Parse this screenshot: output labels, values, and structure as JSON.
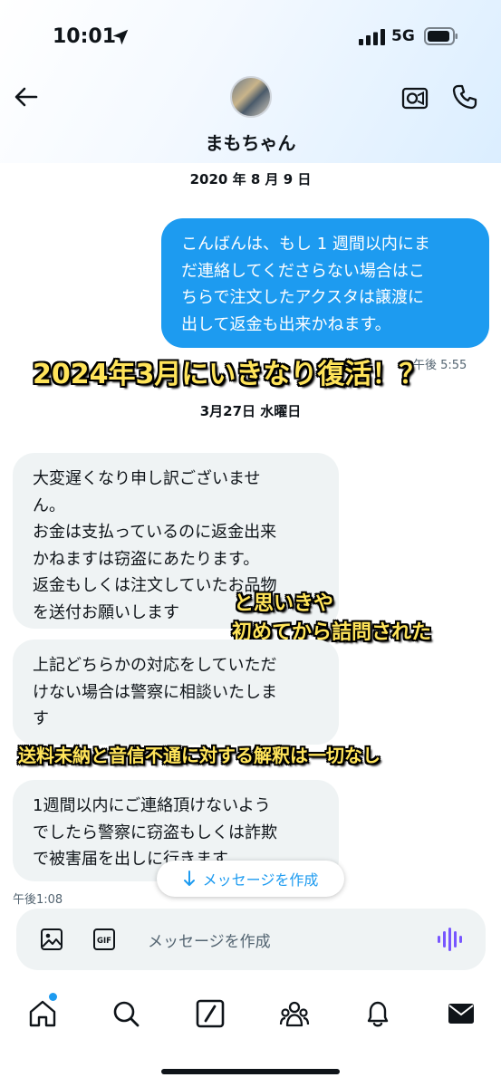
{
  "status_bar": {
    "time": "10:01",
    "network": "5G"
  },
  "header": {
    "contact_name": "まもちゃん"
  },
  "messages": {
    "date1": "2020 年 8 月 9 日",
    "outgoing_1": {
      "lines": [
        "こんばんは、もし 1 週間以内にま",
        "だ連絡してくださらない場合はこ",
        "ちらで注文したアクスタは譲渡に",
        "出して返金も出来かねます。"
      ],
      "time": "午後 5:55"
    },
    "date2": "3月27日 水曜日",
    "incoming_1": {
      "lines": [
        "大変遅くなり申し訳ございませ",
        "ん。",
        "お金は支払っているのに返金出来",
        "かねますは窃盗にあたります。",
        "返金もしくは注文していたお品物",
        "を送付お願いします"
      ]
    },
    "incoming_2": {
      "lines": [
        "上記どちらかの対応をしていただ",
        "けない場合は警察に相談いたしま",
        "す"
      ]
    },
    "incoming_3": {
      "lines": [
        "1週間以内にご連絡頂けないよう",
        "でしたら警察に窃盗もしくは詐欺",
        "で被害届を出しに行きます"
      ],
      "time": "午後1:08"
    }
  },
  "overlays": {
    "caption_1": "2024年3月にいきなり復活！？",
    "caption_2_line1": "と思いきや",
    "caption_2_line2": "初めてから詰問された",
    "caption_3": "送料未納と音信不通に対する解釈は一切なし"
  },
  "compose_button": {
    "label": "メッセージを作成"
  },
  "input": {
    "placeholder": "メッセージを作成"
  },
  "icons": {
    "back": "back-arrow-icon",
    "video": "video-icon",
    "phone": "phone-icon",
    "image": "image-icon",
    "gif": "gif-icon",
    "voice": "voice-icon",
    "tabs": [
      "home-icon",
      "search-icon",
      "grok-icon",
      "communities-icon",
      "notifications-icon",
      "messages-icon"
    ]
  },
  "colors": {
    "accent": "#1d9bf0",
    "incoming_bubble": "#eff3f4",
    "caption": "#ffe45a"
  }
}
